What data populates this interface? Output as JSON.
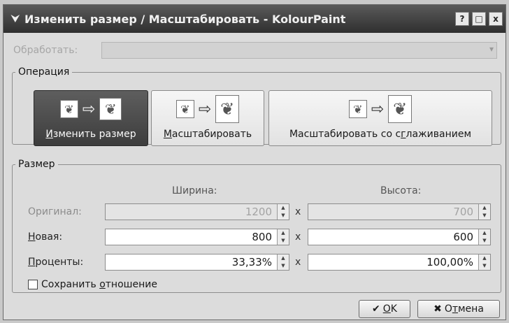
{
  "window": {
    "title": "Изменить размер / Масштабировать - KolourPaint",
    "title_icon": "resize-icon",
    "buttons": {
      "help": "?",
      "maximize": "□",
      "close": "x"
    }
  },
  "apply_to": {
    "label": "Обработать:",
    "value": ""
  },
  "operation": {
    "legend": "Операция",
    "buttons": [
      {
        "label_pre": "",
        "label_u": "И",
        "label_post": "зменить размер",
        "active": true
      },
      {
        "label_pre": "",
        "label_u": "М",
        "label_post": "асштабировать",
        "active": false
      },
      {
        "label_pre": "Масштабировать со с",
        "label_u": "г",
        "label_post": "лаживанием",
        "active": false
      }
    ]
  },
  "size": {
    "legend": "Размер",
    "width_header": "Ширина:",
    "height_header": "Высота:",
    "times": "x",
    "rows": [
      {
        "label_u": "",
        "label_rest": "Оригинал:",
        "width": "1200",
        "height": "700",
        "disabled": true
      },
      {
        "label_u": "Н",
        "label_rest": "овая:",
        "width": "800",
        "height": "600",
        "disabled": false
      },
      {
        "label_u": "П",
        "label_rest": "роценты:",
        "width": "33,33%",
        "height": "100,00%",
        "disabled": false
      }
    ],
    "keep_ratio": {
      "label_pre": "Сохранить ",
      "label_u": "о",
      "label_post": "тношение",
      "checked": false
    }
  },
  "footer": {
    "ok": {
      "label_u": "O",
      "label_rest": "K"
    },
    "cancel": {
      "label_pre": "O",
      "label_u": "т",
      "label_post": "мена"
    }
  }
}
